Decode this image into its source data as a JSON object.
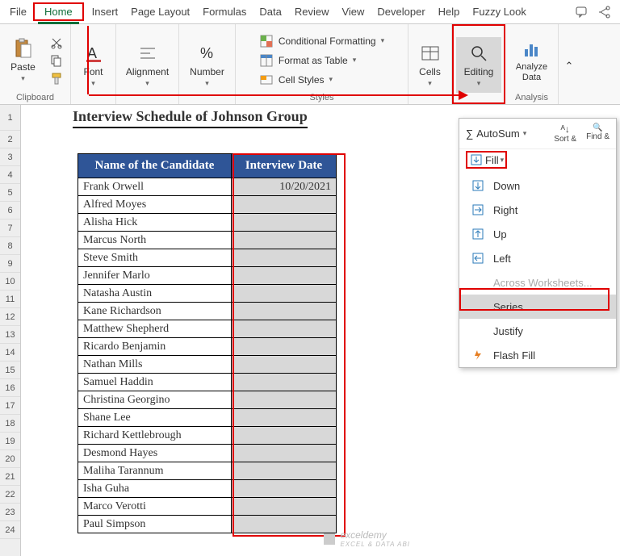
{
  "menu": {
    "file": "File",
    "home": "Home",
    "insert": "Insert",
    "pagelayout": "Page Layout",
    "formulas": "Formulas",
    "data": "Data",
    "review": "Review",
    "view": "View",
    "developer": "Developer",
    "help": "Help",
    "fuzzy": "Fuzzy Look"
  },
  "ribbon": {
    "clipboard": "Clipboard",
    "paste": "Paste",
    "font": "Font",
    "alignment": "Alignment",
    "number": "Number",
    "styles": "Styles",
    "cond": "Conditional Formatting",
    "fmtTable": "Format as Table",
    "cellStyles": "Cell Styles",
    "cells": "Cells",
    "editing": "Editing",
    "analyze": "Analyze Data",
    "analysis": "Analysis"
  },
  "sheet": {
    "title": "Interview Schedule of Johnson Group",
    "headers": {
      "name": "Name of the Candidate",
      "date": "Interview Date"
    },
    "firstDate": "10/20/2021",
    "names": [
      "Frank Orwell",
      "Alfred Moyes",
      "Alisha Hick",
      "Marcus North",
      "Steve Smith",
      "Jennifer Marlo",
      "Natasha Austin",
      "Kane Richardson",
      "Matthew Shepherd",
      "Ricardo Benjamin",
      "Nathan Mills",
      "Samuel Haddin",
      "Christina Georgino",
      "Shane Lee",
      "Richard Kettlebrough",
      "Desmond Hayes",
      "Maliha Tarannum",
      "Isha Guha",
      "Marco Verotti",
      "Paul Simpson"
    ],
    "rowNums": [
      "1",
      "2",
      "3",
      "4",
      "5",
      "6",
      "7",
      "8",
      "9",
      "10",
      "11",
      "12",
      "13",
      "14",
      "15",
      "16",
      "17",
      "18",
      "19",
      "20",
      "21",
      "22",
      "23",
      "24"
    ]
  },
  "panel": {
    "autosum": "AutoSum",
    "fill": "Fill",
    "sort": "Sort &",
    "find": "Find &",
    "down": "Down",
    "right": "Right",
    "up": "Up",
    "left": "Left",
    "across": "Across Worksheets...",
    "series": "Series...",
    "justify": "Justify",
    "flash": "Flash Fill"
  },
  "watermark": {
    "main": "exceldemy",
    "sub": "EXCEL & DATA ABI"
  }
}
